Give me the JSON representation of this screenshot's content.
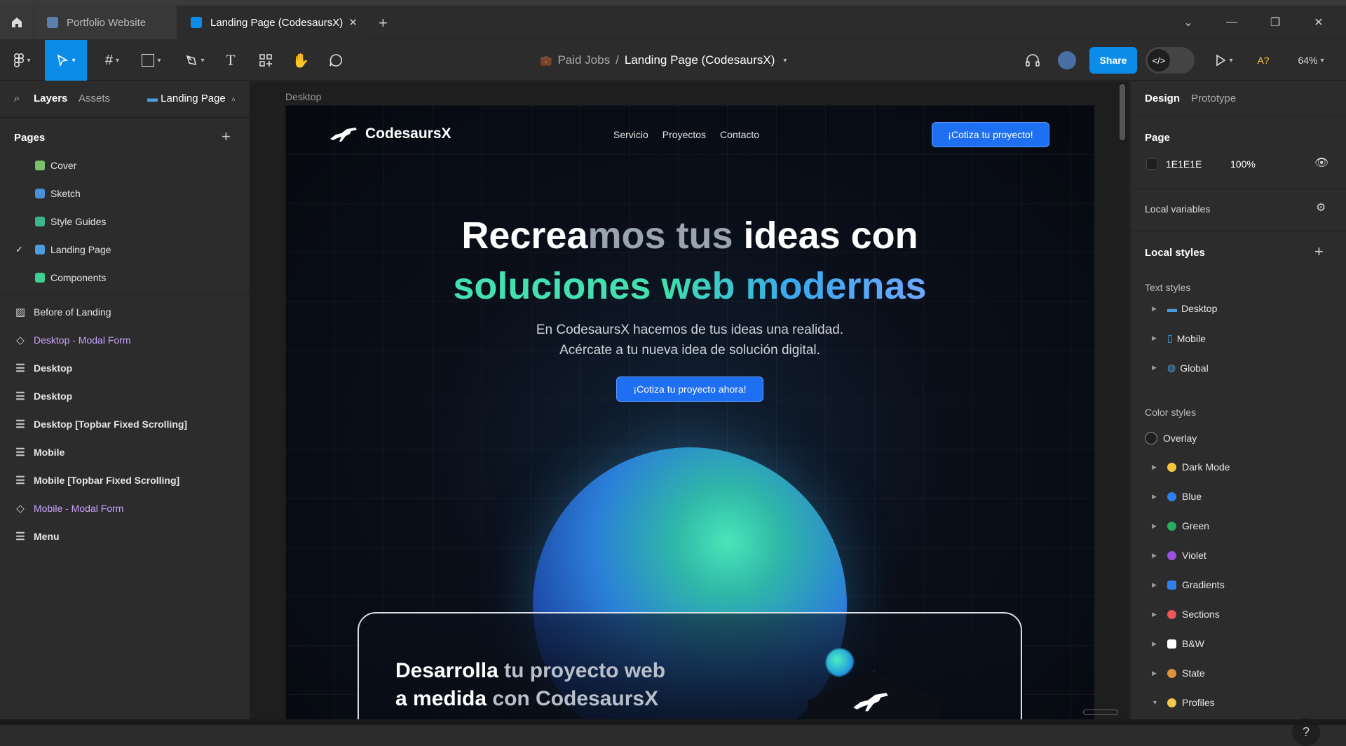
{
  "tabs": [
    {
      "label": "Portfolio Website"
    },
    {
      "label": "Landing Page (CodesaursX)"
    }
  ],
  "toolbar": {
    "breadcrumb_project": "Paid Jobs",
    "breadcrumb_sep": "/",
    "breadcrumb_file": "Landing Page (CodesaursX)",
    "share_label": "Share",
    "missing_fonts": "A?",
    "zoom": "64%"
  },
  "left_panel": {
    "tab_layers": "Layers",
    "tab_assets": "Assets",
    "page_selector": "Landing Page",
    "pages_title": "Pages",
    "pages": [
      {
        "label": "Cover",
        "color": "#7bbf6a"
      },
      {
        "label": "Sketch",
        "color": "#4a90d9"
      },
      {
        "label": "Style Guides",
        "color": "#3bb58a"
      },
      {
        "label": "Landing Page",
        "color": "#4a9ee0",
        "selected": true
      },
      {
        "label": "Components",
        "color": "#3ecf8e"
      }
    ],
    "layers": [
      {
        "label": "Before of Landing",
        "icon": "image-icon"
      },
      {
        "label": "Desktop - Modal Form",
        "icon": "component-icon"
      },
      {
        "label": "Desktop",
        "icon": "frame-icon"
      },
      {
        "label": "Desktop",
        "icon": "frame-icon"
      },
      {
        "label": "Desktop [Topbar Fixed Scrolling]",
        "icon": "frame-icon"
      },
      {
        "label": "Mobile",
        "icon": "frame-icon"
      },
      {
        "label": "Mobile [Topbar Fixed Scrolling]",
        "icon": "frame-icon"
      },
      {
        "label": "Mobile - Modal Form",
        "icon": "component-icon"
      },
      {
        "label": "Menu",
        "icon": "frame-icon"
      }
    ]
  },
  "canvas": {
    "frame_label": "Desktop",
    "brand": "CodesaursX",
    "nav_links": [
      "Servicio",
      "Proyectos",
      "Contacto"
    ],
    "nav_cta": "¡Cotiza tu proyecto!",
    "headline_line1_a": "Recrea",
    "headline_line1_b": "mos",
    "headline_line1_c": " tus ",
    "headline_line1_d": "ideas con",
    "headline_line2_a": "soluciones ",
    "headline_line2_b": "web modernas",
    "subtitle_line1": "En CodesaursX hacemos de tus ideas una realidad.",
    "subtitle_line2": "Acércate a tu nueva idea de solución digital.",
    "hero_cta": "¡Cotiza tu proyecto ahora!",
    "card_line1_a": "Desarrolla ",
    "card_line1_b": "tu proyecto web",
    "card_line2_a": "a medida ",
    "card_line2_b": "con CodesaursX"
  },
  "right_panel": {
    "tab_design": "Design",
    "tab_prototype": "Prototype",
    "page_title": "Page",
    "page_color": "1E1E1E",
    "page_opacity": "100%",
    "local_variables": "Local variables",
    "local_styles": "Local styles",
    "text_styles_title": "Text styles",
    "text_styles": [
      {
        "label": "Desktop",
        "icon": "desktop-icon"
      },
      {
        "label": "Mobile",
        "icon": "mobile-icon"
      },
      {
        "label": "Global",
        "icon": "globe-icon"
      }
    ],
    "color_styles_title": "Color styles",
    "color_styles": [
      {
        "label": "Overlay",
        "color": "#1f1f1f"
      },
      {
        "label": "Dark Mode",
        "color": "#f5c542"
      },
      {
        "label": "Blue",
        "color": "#2f80ed"
      },
      {
        "label": "Green",
        "color": "#27ae60"
      },
      {
        "label": "Violet",
        "color": "#9b51e0"
      },
      {
        "label": "Gradients",
        "color": "#2f80ed"
      },
      {
        "label": "Sections",
        "color": "#eb5757"
      },
      {
        "label": "B&W",
        "color": "#ffffff"
      },
      {
        "label": "State",
        "color": "#e0913b"
      },
      {
        "label": "Profiles",
        "color": "#f2c94c"
      }
    ]
  },
  "colors": {
    "accent": "#0c8ce9",
    "cta": "#1e6ff2",
    "headline_green": "#44e0b0"
  }
}
